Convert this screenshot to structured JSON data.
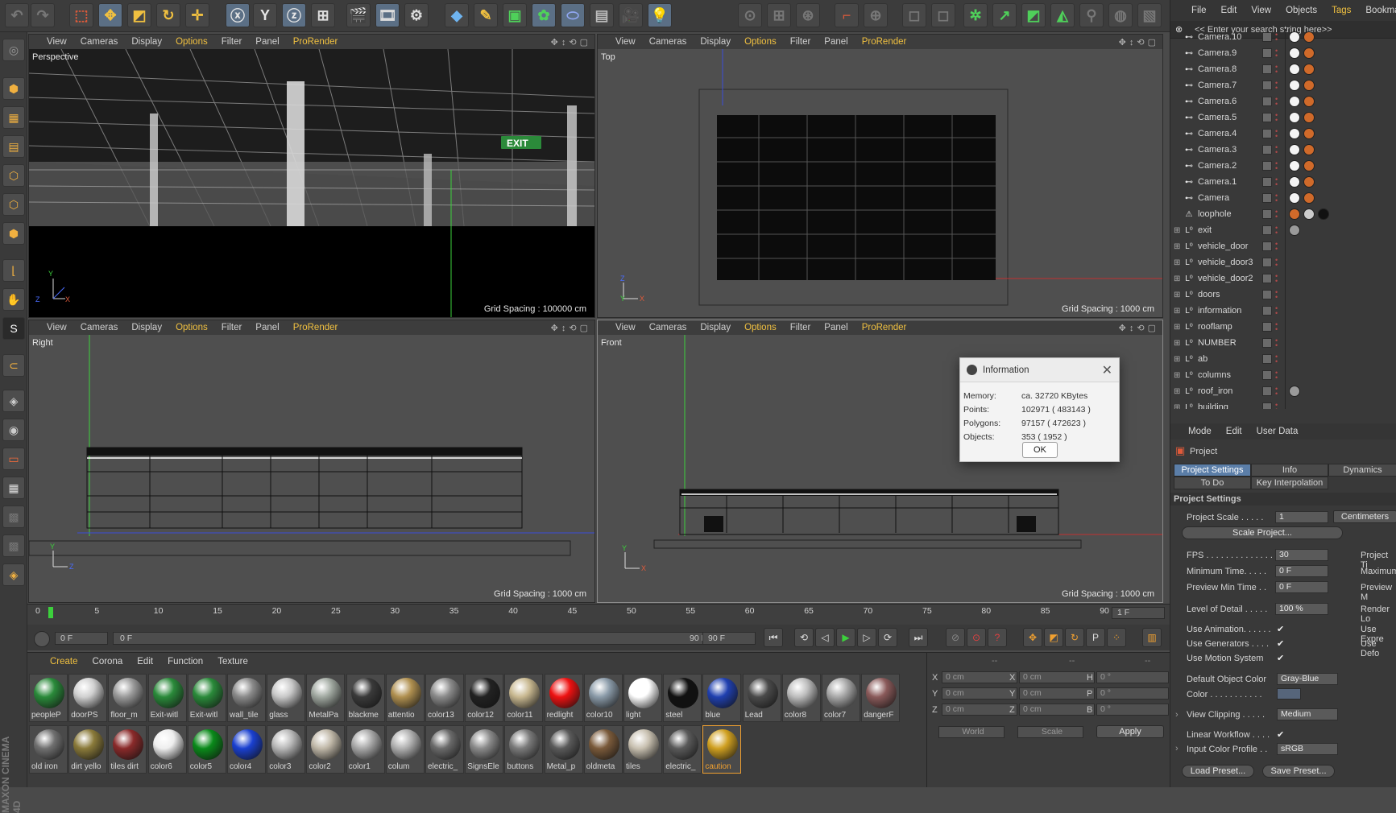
{
  "viewport_menu": [
    "View",
    "Cameras",
    "Display",
    "Options",
    "Filter",
    "Panel",
    "ProRender"
  ],
  "viewports": [
    {
      "label": "Perspective",
      "grid": "Grid Spacing : 100000 cm"
    },
    {
      "label": "Top",
      "grid": "Grid Spacing : 1000 cm"
    },
    {
      "label": "Right",
      "grid": "Grid Spacing : 1000 cm"
    },
    {
      "label": "Front",
      "grid": "Grid Spacing : 1000 cm"
    }
  ],
  "exit_sign": "EXIT",
  "object_menu": {
    "file": "File",
    "edit": "Edit",
    "view": "View",
    "objects": "Objects",
    "tags": "Tags",
    "bookmarks": "Bookmarks"
  },
  "search_placeholder": "<< Enter your search string here>>",
  "objects": [
    "Camera.10",
    "Camera.9",
    "Camera.8",
    "Camera.7",
    "Camera.6",
    "Camera.5",
    "Camera.4",
    "Camera.3",
    "Camera.2",
    "Camera.1",
    "Camera",
    "loophole",
    "exit",
    "vehicle_door",
    "vehicle_door3",
    "vehicle_door2",
    "doors",
    "information",
    "rooflamp",
    "NUMBER",
    "ab",
    "columns",
    "roof_iron",
    "building"
  ],
  "attr_menu": {
    "mode": "Mode",
    "edit": "Edit",
    "user_data": "User Data"
  },
  "attr": {
    "header": "Project",
    "tab_project_settings": "Project Settings",
    "tab_info": "Info",
    "tab_dynamics": "Dynamics",
    "tab_todo": "To Do",
    "tab_key_interp": "Key Interpolation",
    "section": "Project Settings",
    "project_scale_label": "Project Scale . . . . .",
    "project_scale_value": "1",
    "project_scale_unit": "Centimeters",
    "scale_project_btn": "Scale Project...",
    "fps_label": "FPS . . . . . . . . . . . . . . .",
    "fps_value": "30",
    "project_time_label": "Project Ti",
    "min_time_label": "Minimum Time. . . . .",
    "min_time_value": "0 F",
    "max_label": "Maximum",
    "preview_min_label": "Preview Min Time . .",
    "preview_min_value": "0 F",
    "preview_max_label": "Preview M",
    "lod_label": "Level of Detail . . . . .",
    "lod_value": "100 %",
    "render_label": "Render Lo",
    "use_anim_label": "Use Animation. . . . . .",
    "use_expr_label": "Use Expre",
    "use_gen_label": "Use Generators . . . .",
    "use_def_label": "Use Defo",
    "use_motion_label": "Use Motion System",
    "def_color_label": "Default Object Color",
    "def_color_value": "Gray-Blue",
    "color_label": "Color . . . . . . . . . . .",
    "view_clip_label": "View Clipping . . . . .",
    "view_clip_value": "Medium",
    "linear_label": "Linear Workflow . . . .",
    "input_profile_label": "Input Color Profile . .",
    "input_profile_value": "sRGB",
    "load_preset": "Load Preset...",
    "save_preset": "Save Preset..."
  },
  "timeline_ticks": [
    "0",
    "5",
    "10",
    "15",
    "20",
    "25",
    "30",
    "35",
    "40",
    "45",
    "50",
    "55",
    "60",
    "65",
    "70",
    "75",
    "80",
    "85",
    "90"
  ],
  "timeline_end": "1 F",
  "transport": {
    "start": "0 F",
    "slider_start": "0 F",
    "slider_end": "90 F",
    "end": "90 F"
  },
  "material_menu": [
    "Create",
    "Corona",
    "Edit",
    "Function",
    "Texture"
  ],
  "materials_row1": [
    "peopleP",
    "doorPS",
    "floor_m",
    "Exit-witl",
    "Exit-witl",
    "wall_tile",
    "glass",
    "MetalPa",
    "blackme",
    "attentio",
    "color13",
    "color12",
    "color11",
    "redlight",
    "color10",
    "light",
    "steel",
    "blue",
    "Lead",
    "color8",
    "color7",
    "dangerF"
  ],
  "materials_row2": [
    "old iron",
    "dirt yello",
    "tiles dirt",
    "color6",
    "color5",
    "color4",
    "color3",
    "color2",
    "color1",
    "colum",
    "electric_",
    "SignsEle",
    "buttons",
    "Metal_p",
    "oldmeta",
    "tiles",
    "electric_",
    "caution"
  ],
  "coords": {
    "x": "X",
    "y": "Y",
    "z": "Z",
    "h": "H",
    "p": "P",
    "b": "B",
    "pos_x": "0 cm",
    "pos_y": "0 cm",
    "pos_z": "0 cm",
    "size_x": "0 cm",
    "size_y": "0 cm",
    "size_z": "0 cm",
    "rot_h": "0 °",
    "rot_p": "0 °",
    "rot_b": "0 °",
    "world": "World",
    "scale": "Scale",
    "apply": "Apply",
    "dash": "--"
  },
  "dialog": {
    "title": "Information",
    "memory_label": "Memory:",
    "memory_value": "ca. 32720 KBytes",
    "points_label": "Points:",
    "points_value": "102971 ( 483143 )",
    "polygons_label": "Polygons:",
    "polygons_value": "97157 ( 472623 )",
    "objects_label": "Objects:",
    "objects_value": "353 ( 1952 )",
    "ok": "OK"
  },
  "branding": "MAXON CINEMA 4D",
  "colors": {
    "accent": "#f0c040",
    "selection": "#5b7ea8"
  }
}
